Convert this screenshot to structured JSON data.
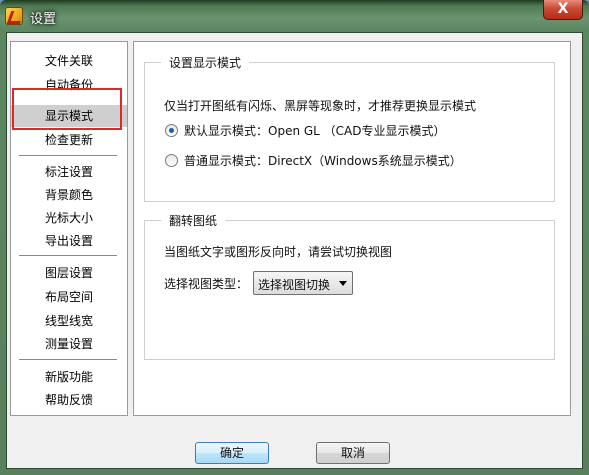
{
  "window": {
    "title": "设置",
    "close_label": "X"
  },
  "sidebar": {
    "items": [
      {
        "label": "文件关联",
        "selected": false
      },
      {
        "label": "自动备份",
        "selected": false
      },
      {
        "label": "显示模式",
        "selected": true
      },
      {
        "label": "检查更新",
        "selected": false
      },
      {
        "label": "标注设置",
        "selected": false
      },
      {
        "label": "背景颜色",
        "selected": false
      },
      {
        "label": "光标大小",
        "selected": false
      },
      {
        "label": "导出设置",
        "selected": false
      },
      {
        "label": "图层设置",
        "selected": false
      },
      {
        "label": "布局空间",
        "selected": false
      },
      {
        "label": "线型线宽",
        "selected": false
      },
      {
        "label": "测量设置",
        "selected": false
      },
      {
        "label": "新版功能",
        "selected": false
      },
      {
        "label": "帮助反馈",
        "selected": false
      }
    ]
  },
  "display_mode": {
    "group_title": "设置显示模式",
    "description": "仅当打开图纸有闪烁、黑屏等现象时，才推荐更换显示模式",
    "options": [
      {
        "label": "默认显示模式：Open GL （CAD专业显示模式）",
        "checked": true
      },
      {
        "label": "普通显示模式：DirectX（Windows系统显示模式）",
        "checked": false
      }
    ]
  },
  "flip": {
    "group_title": "翻转图纸",
    "description": "当图纸文字或图形反向时，请尝试切换视图",
    "view_type_label": "选择视图类型：",
    "view_type_value": "选择视图切换"
  },
  "buttons": {
    "ok": "确定",
    "cancel": "取消"
  },
  "colors": {
    "highlight_box": "#e0282a",
    "selected_bg": "#cfcfcf",
    "radio_dot": "#1d5fa8"
  }
}
